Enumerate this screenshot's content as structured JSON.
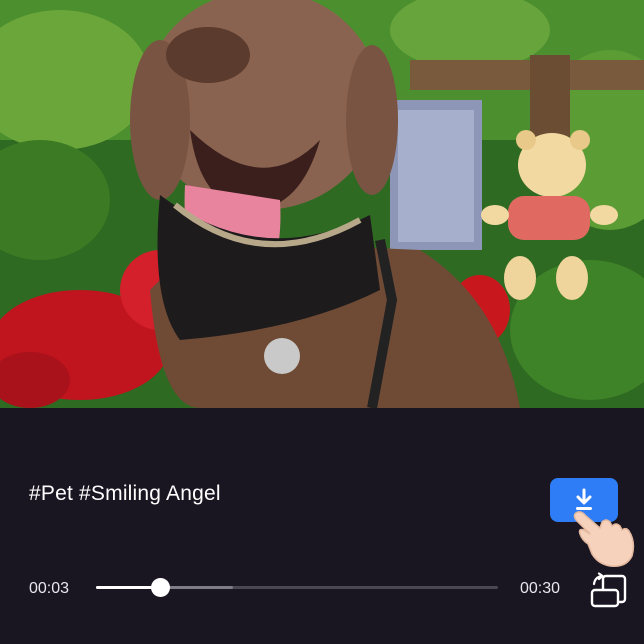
{
  "video": {
    "hashtags": "#Pet #Smiling Angel",
    "current_time": "00:03",
    "duration": "00:30",
    "progress_fraction": 0.158,
    "buffered_fraction": 0.34
  },
  "icons": {
    "download": "download-icon",
    "rotate": "rotate-screen-icon",
    "pointer": "pointing-hand-icon"
  },
  "colors": {
    "panel_background": "#191521",
    "accent": "#2f7df6",
    "text": "#ffffff"
  }
}
